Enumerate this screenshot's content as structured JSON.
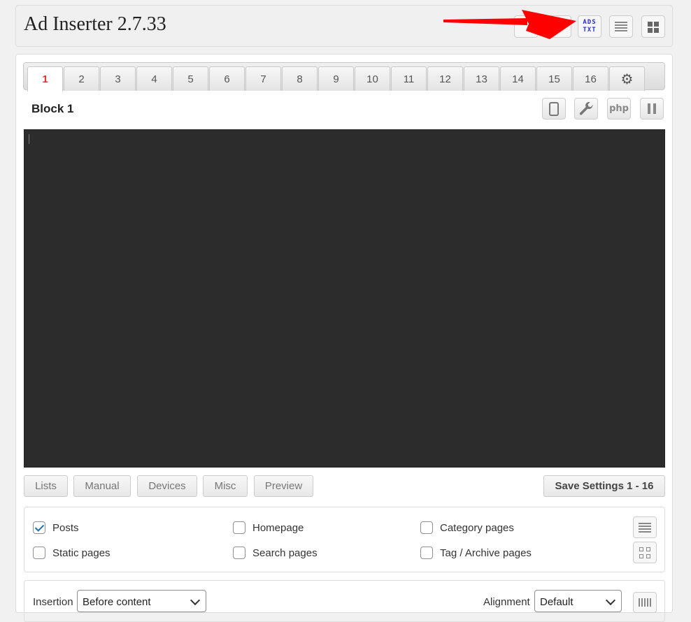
{
  "header": {
    "title": "Ad Inserter 2.7.33",
    "ads_txt_line1": "ADS",
    "ads_txt_line2": "TXT",
    "arrow_color": "#ff0000"
  },
  "tabs": [
    {
      "label": "1",
      "active": true
    },
    {
      "label": "2"
    },
    {
      "label": "3"
    },
    {
      "label": "4"
    },
    {
      "label": "5"
    },
    {
      "label": "6"
    },
    {
      "label": "7"
    },
    {
      "label": "8"
    },
    {
      "label": "9"
    },
    {
      "label": "10"
    },
    {
      "label": "11"
    },
    {
      "label": "12"
    },
    {
      "label": "13"
    },
    {
      "label": "14"
    },
    {
      "label": "15"
    },
    {
      "label": "16"
    }
  ],
  "block": {
    "title": "Block 1",
    "php_label": "php",
    "editor_content": ""
  },
  "buttons": {
    "lists": "Lists",
    "manual": "Manual",
    "devices": "Devices",
    "misc": "Misc",
    "preview": "Preview",
    "save": "Save Settings 1 - 16"
  },
  "checks": {
    "posts": {
      "label": "Posts",
      "checked": true
    },
    "homepage": {
      "label": "Homepage",
      "checked": false
    },
    "category": {
      "label": "Category pages",
      "checked": false
    },
    "static": {
      "label": "Static pages",
      "checked": false
    },
    "search": {
      "label": "Search pages",
      "checked": false
    },
    "tag": {
      "label": "Tag / Archive pages",
      "checked": false
    }
  },
  "insertion": {
    "label": "Insertion",
    "value": "Before content",
    "alignment_label": "Alignment",
    "alignment_value": "Default"
  }
}
